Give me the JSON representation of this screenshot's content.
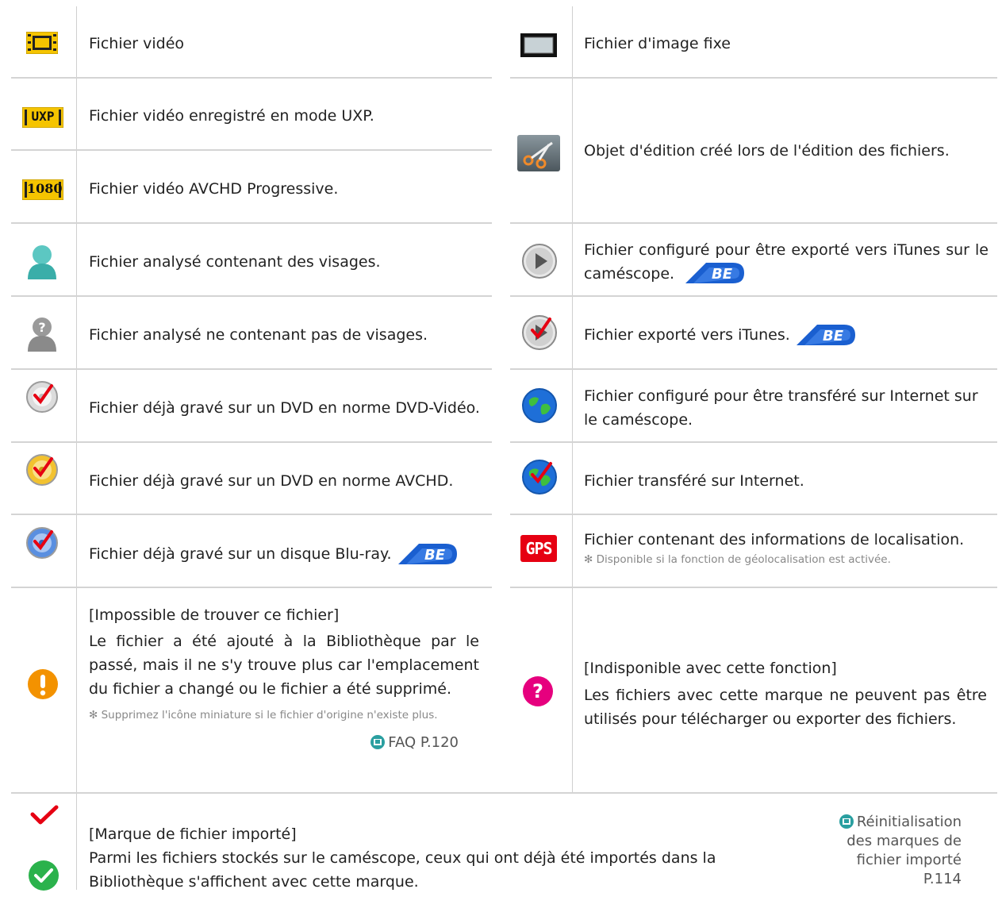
{
  "colors": {
    "rule": "#cfcfcf",
    "note": "#888888",
    "teal": "#2a9fa0",
    "be_blue": "#1a5fd0",
    "orange": "#f39200",
    "magenta": "#e6007e",
    "check_red": "#e60012",
    "check_green": "#2bb24c"
  },
  "left": [
    {
      "icon": "film-strip-icon",
      "text": "Fichier vidéo"
    },
    {
      "icon": "uxp-icon",
      "label": "UXP",
      "text": "Fichier vidéo enregistré en mode UXP."
    },
    {
      "icon": "avchd-1080-icon",
      "label": "1080",
      "text": "Fichier vidéo AVCHD Progressive."
    },
    {
      "icon": "face-detected-icon",
      "text": "Fichier analysé contenant des visages."
    },
    {
      "icon": "no-face-icon",
      "text": "Fichier analysé ne contenant pas de visages."
    },
    {
      "icon": "dvd-video-burned-icon",
      "text": "Fichier déjà gravé sur un DVD en norme DVD-Vidéo."
    },
    {
      "icon": "dvd-avchd-burned-icon",
      "text": "Fichier déjà gravé sur un DVD en norme AVCHD."
    },
    {
      "icon": "bluray-burned-icon",
      "text": "Fichier déjà gravé sur un disque Blu-ray.",
      "badge": "BE"
    },
    {
      "icon": "exclamation-icon",
      "title": "[Impossible de trouver ce fichier]",
      "text": "Le fichier a été ajouté à la Bibliothèque par le passé, mais il ne s'y trouve plus car l'emplacement du fichier a changé ou le fichier a été supprimé.",
      "note": "✻ Supprimez l'icône miniature si le fichier d'origine n'existe plus.",
      "ref": "FAQ P.120"
    }
  ],
  "right": [
    {
      "icon": "still-image-icon",
      "text": "Fichier d'image fixe"
    },
    {
      "icon": "scissors-icon",
      "text": "Objet d'édition créé lors de l'édition des fichiers."
    },
    {
      "icon": "play-icon",
      "text": "Fichier configuré pour être exporté vers iTunes sur le caméscope.",
      "badge": "BE"
    },
    {
      "icon": "play-check-icon",
      "text": "Fichier exporté vers iTunes.",
      "badge": "BE"
    },
    {
      "icon": "globe-icon",
      "text": "Fichier configuré pour être transféré sur Internet sur le caméscope."
    },
    {
      "icon": "globe-check-icon",
      "text": "Fichier transféré sur Internet."
    },
    {
      "icon": "gps-icon",
      "label": "GPS",
      "text": "Fichier contenant des informations de localisation.",
      "note": "✻ Disponible si la fonction de géolocalisation est activée."
    },
    {
      "icon": "question-icon",
      "label": "?",
      "title": "[Indisponible avec cette fonction]",
      "text": "Les fichiers avec cette marque ne peuvent pas être utilisés pour télécharger ou exporter des fichiers."
    }
  ],
  "bottom": {
    "title": "[Marque de fichier importé]",
    "text": "Parmi les fichiers stockés sur le caméscope, ceux qui ont déjà été importés dans la Bibliothèque s'affichent avec cette marque.",
    "ref_lines": [
      "Réinitialisation",
      "des marques de",
      "fichier importé",
      "P.114"
    ]
  }
}
